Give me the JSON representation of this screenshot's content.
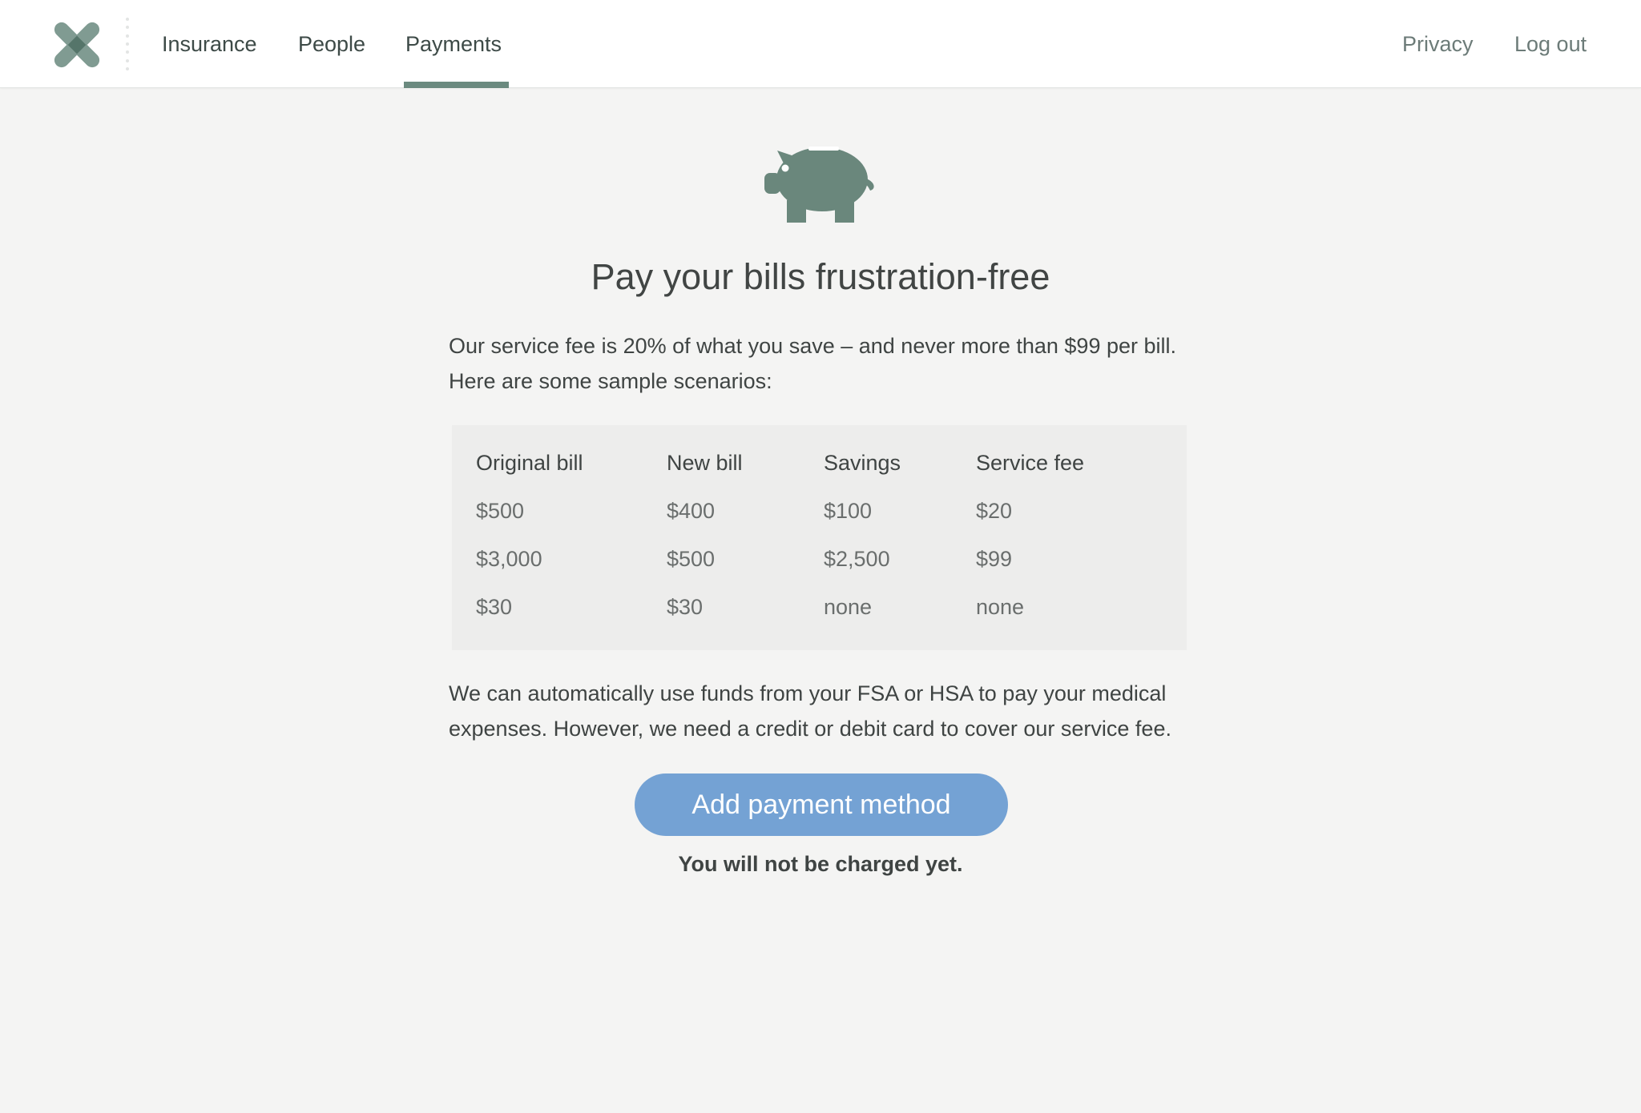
{
  "nav": {
    "left": [
      {
        "label": "Insurance"
      },
      {
        "label": "People"
      },
      {
        "label": "Payments",
        "active": true
      }
    ],
    "right": [
      {
        "label": "Privacy"
      },
      {
        "label": "Log out"
      }
    ]
  },
  "main": {
    "icon": "piggy-bank-icon",
    "headline": "Pay your bills frustration-free",
    "intro_line1": "Our service fee is 20% of what you save – and never more than $99 per bill.",
    "intro_line2": "Here are some sample scenarios:",
    "table": {
      "headers": [
        "Original bill",
        "New bill",
        "Savings",
        "Service fee"
      ],
      "rows": [
        [
          "$500",
          "$400",
          "$100",
          "$20"
        ],
        [
          "$3,000",
          "$500",
          "$2,500",
          "$99"
        ],
        [
          "$30",
          "$30",
          "none",
          "none"
        ]
      ]
    },
    "fsa_line1": "We can automatically use funds from your FSA or HSA to pay your medical",
    "fsa_line2": "expenses. However, we need a credit or debit card to cover our service fee.",
    "cta_label": "Add payment method",
    "note": "You will not be charged yet."
  },
  "colors": {
    "brand_green": "#6b8a7f",
    "cta_blue": "#74a2d4",
    "background": "#f4f4f3"
  }
}
